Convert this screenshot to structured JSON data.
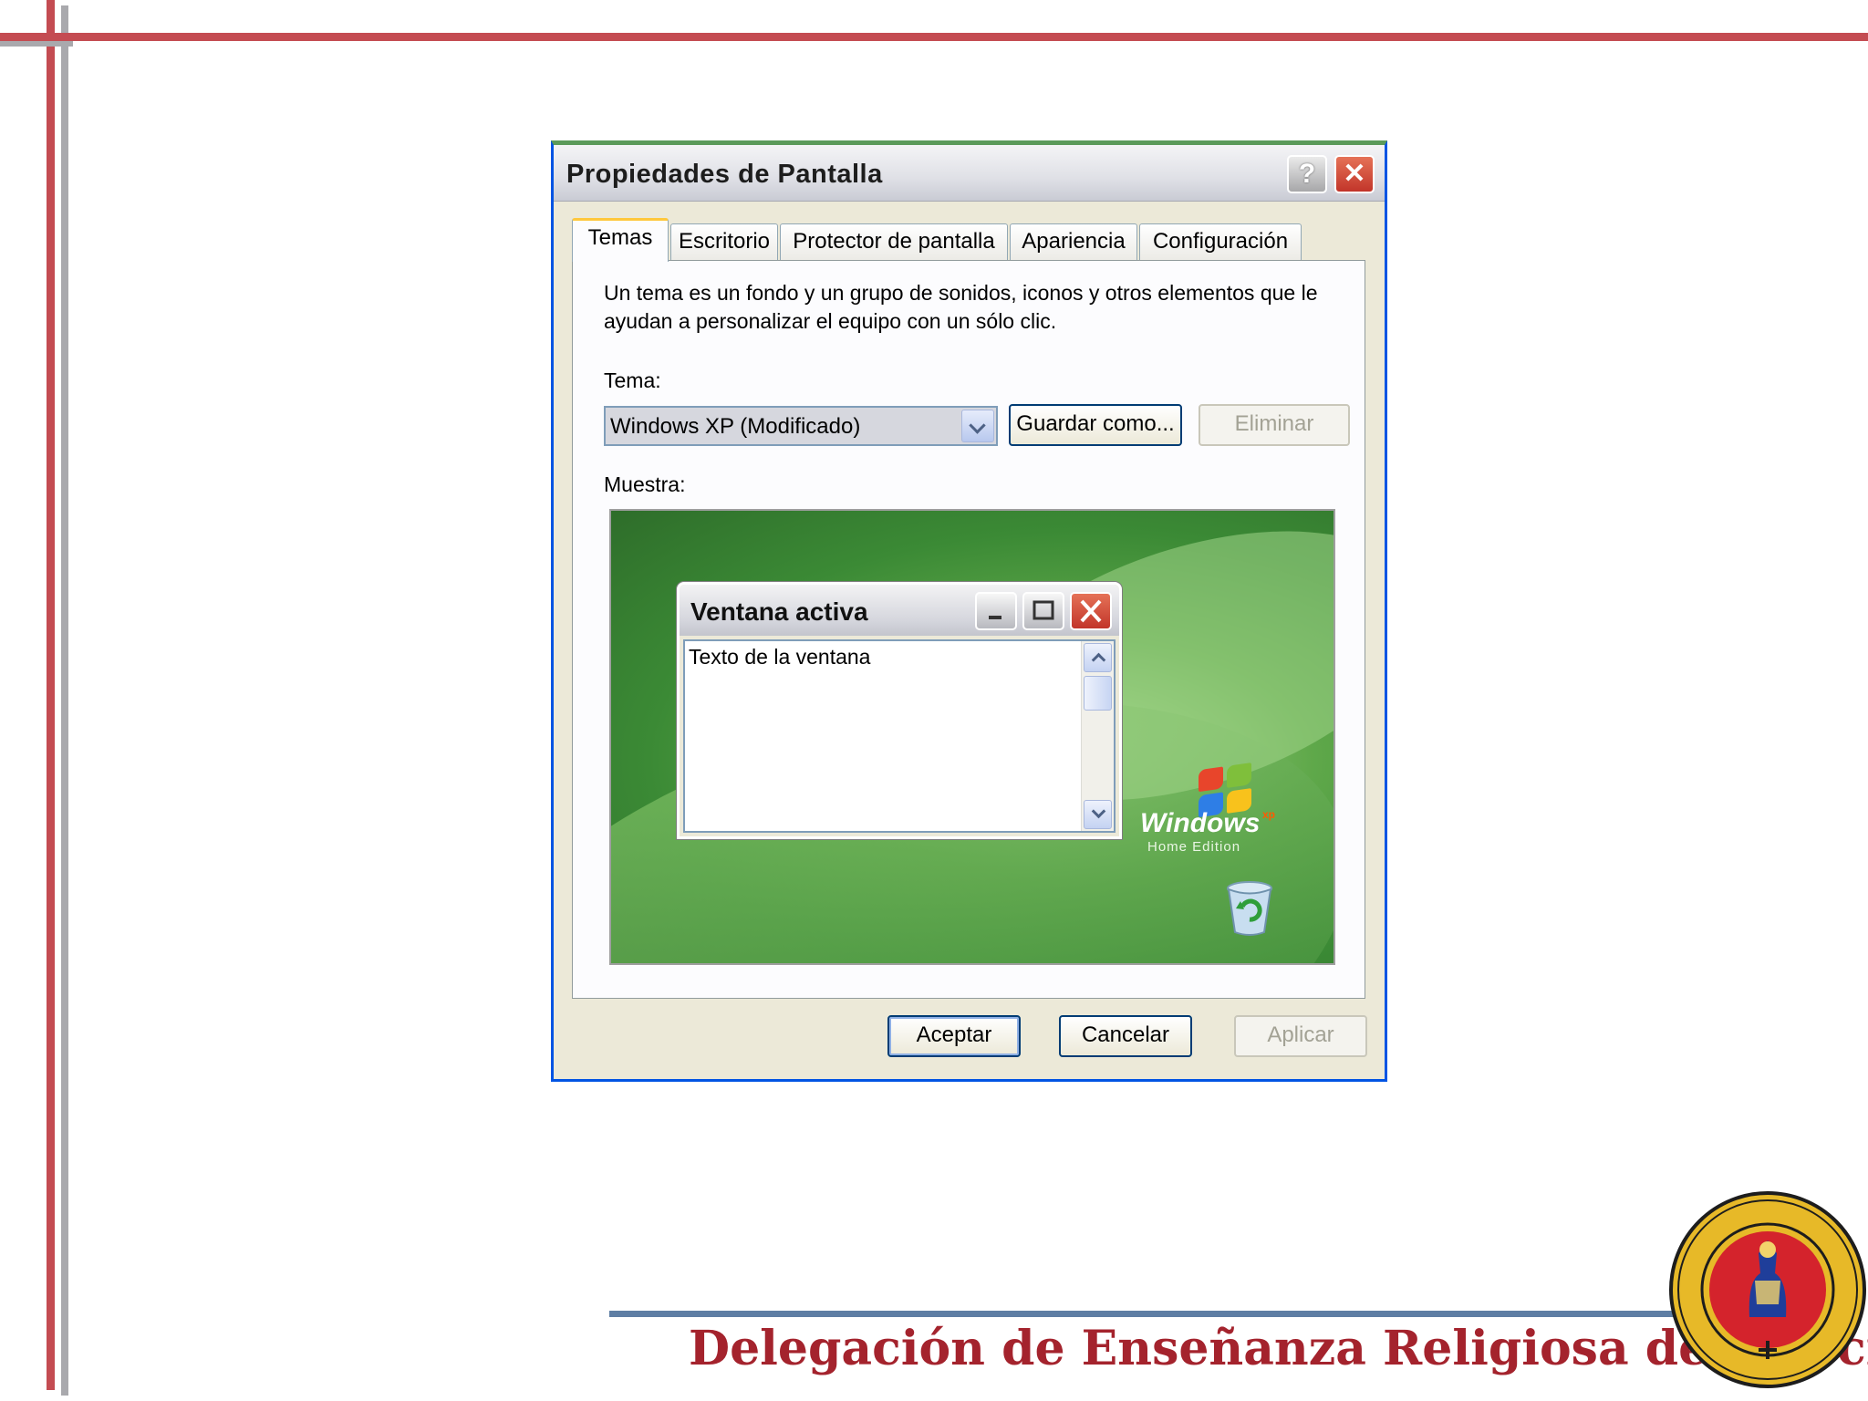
{
  "dialog": {
    "title": "Propiedades de Pantalla",
    "help_glyph": "?",
    "close_glyph": "✕"
  },
  "tabs": [
    {
      "label": "Temas",
      "active": true
    },
    {
      "label": "Escritorio"
    },
    {
      "label": "Protector de pantalla"
    },
    {
      "label": "Apariencia"
    },
    {
      "label": "Configuración"
    }
  ],
  "temas": {
    "intro": "Un tema es un fondo y un grupo de sonidos, iconos y otros elementos que le ayudan a personalizar el equipo con un sólo clic.",
    "tema_label": "Tema:",
    "selected_theme": "Windows XP (Modificado)",
    "save_as_label": "Guardar como...",
    "delete_label": "Eliminar",
    "sample_label": "Muestra:"
  },
  "preview": {
    "window_title": "Ventana activa",
    "window_text": "Texto de la ventana",
    "logo_word": "Windows",
    "logo_sup": "xp",
    "logo_edition": "Home Edition"
  },
  "buttons": {
    "ok_label": "Aceptar",
    "cancel_label": "Cancelar",
    "apply_label": "Aplicar"
  },
  "footer": {
    "text": "Delegación de Enseñanza Religiosa de Murcia"
  },
  "colors": {
    "slide_accent_red": "#c44c52",
    "slide_accent_gray": "#a9a9ad",
    "footer_text": "#a4232d",
    "footer_line": "#5e7ea4",
    "xp_close_red": "#c2352a",
    "xp_button_border": "#003c74"
  },
  "icons": {
    "help": "help-icon",
    "close": "close-icon",
    "dropdown": "chevron-down-icon",
    "minimize": "minimize-icon",
    "maximize": "maximize-icon",
    "recycle_bin": "recycle-bin-icon",
    "seal": "diocesan-seal-logo"
  }
}
